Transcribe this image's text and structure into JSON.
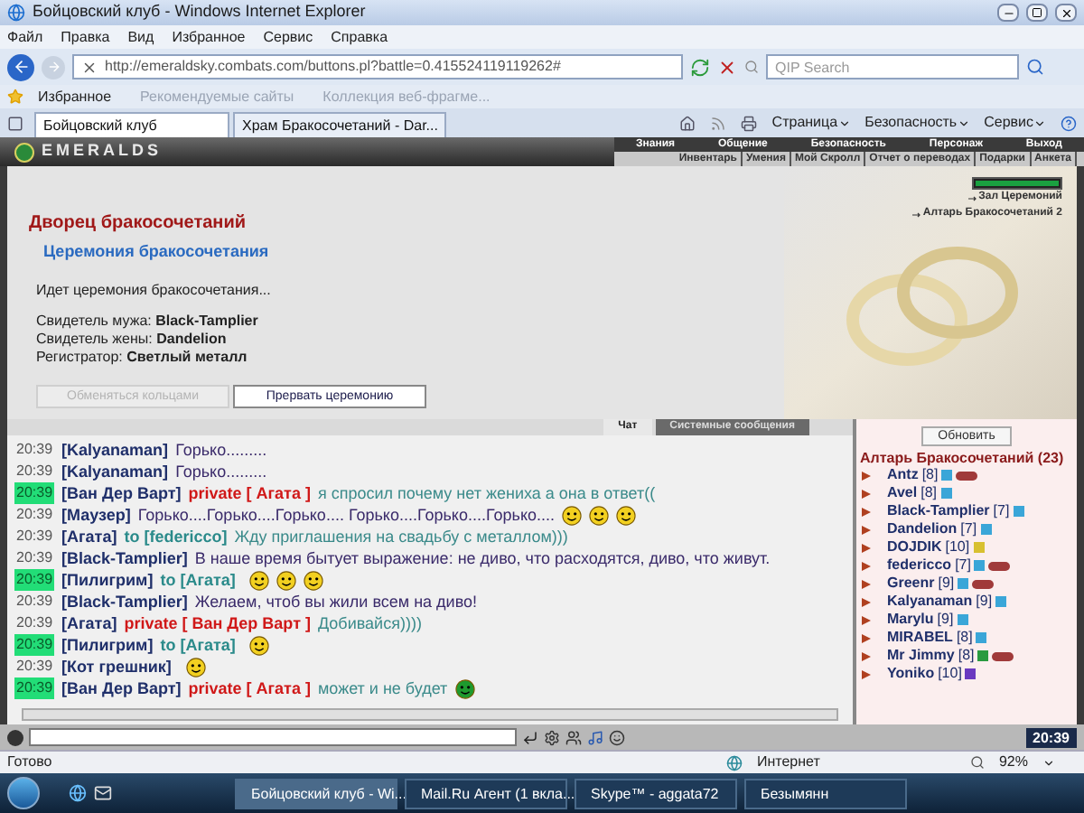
{
  "window": {
    "title": "Бойцовский клуб - Windows Internet Explorer"
  },
  "menu": [
    "Файл",
    "Правка",
    "Вид",
    "Избранное",
    "Сервис",
    "Справка"
  ],
  "address": {
    "value": "http://emeraldsky.combats.com/buttons.pl?battle=0.415524119119262#"
  },
  "search": {
    "placeholder": "QIP Search"
  },
  "favorites": {
    "label": "Избранное",
    "links": [
      "Рекомендуемые сайты",
      "Коллекция веб-фрагме..."
    ]
  },
  "tabs": [
    {
      "label": "Бойцовский клуб",
      "selected": true
    },
    {
      "label": "Храм Бракосочетаний - Dar...",
      "selected": false
    }
  ],
  "commands": [
    "Страница",
    "Безопасность",
    "Сервис"
  ],
  "game_nav": {
    "logo": "EMERALDS",
    "top": [
      "Знания",
      "Общение",
      "Безопасность",
      "Персонаж",
      "Выход"
    ],
    "sub": [
      "Инвентарь",
      "Умения",
      "Мой Скролл",
      "Отчет о переводах",
      "Подарки",
      "Анкета"
    ]
  },
  "content": {
    "title": "Дворец бракосочетаний",
    "subtitle": "Церемония бракосочетания",
    "status": "Идет церемония бракосочетания...",
    "fields": [
      {
        "label": "Свидетель мужа:",
        "value": "Black-Tamplier"
      },
      {
        "label": "Свидетель жены:",
        "value": "Dandelion"
      },
      {
        "label": "Регистратор:",
        "value": "Светлый металл"
      }
    ],
    "buttons": [
      {
        "label": "Обменяться кольцами",
        "disabled": true
      },
      {
        "label": "Прервать церемонию",
        "disabled": false
      }
    ],
    "health": {
      "level": 1
    },
    "locations": [
      "Зал Церемоний",
      "Алтарь Бракосочетаний 2"
    ]
  },
  "chat_tabs": [
    {
      "label": "Чат",
      "selected": true
    },
    {
      "label": "Системные сообщения",
      "selected": false
    }
  ],
  "messages": [
    {
      "time": "20:39",
      "highlighted": false,
      "author": "[Kalyanaman]",
      "kind": "plain",
      "text": "Горько........."
    },
    {
      "time": "20:39",
      "highlighted": false,
      "author": "[Kalyanaman]",
      "kind": "plain",
      "text": "Горько........."
    },
    {
      "time": "20:39",
      "highlighted": true,
      "author": "[Ван Дер Варт]",
      "kind": "private",
      "target": "private [ Агата ]",
      "text": "я спросил почему нет жениха а она в ответ(("
    },
    {
      "time": "20:39",
      "highlighted": false,
      "author": "[Маузер]",
      "kind": "plain",
      "text": "Горько....Горько....Горько.... Горько....Горько....Горько....",
      "smileys": [
        {
          "kind": "yellow"
        },
        {
          "kind": "yellow"
        },
        {
          "kind": "yellow"
        }
      ]
    },
    {
      "time": "20:39",
      "highlighted": false,
      "author": "[Агата]",
      "kind": "to",
      "target": "to [federicco]",
      "text": "Жду приглашения на свадьбу с металлом)))"
    },
    {
      "time": "20:39",
      "highlighted": false,
      "author": "[Black-Tamplier]",
      "kind": "plain",
      "text": "В наше время бытует выражение: не диво, что расходятся, диво, что живут."
    },
    {
      "time": "20:39",
      "highlighted": true,
      "author": "[Пилигрим]",
      "kind": "to",
      "target": "to [Агата]",
      "smileys": [
        {
          "kind": "yellow"
        },
        {
          "kind": "yellow"
        },
        {
          "kind": "yellow"
        }
      ]
    },
    {
      "time": "20:39",
      "highlighted": false,
      "author": "[Black-Tamplier]",
      "kind": "plain",
      "text": "Желаем, чтоб вы жили всем на диво!"
    },
    {
      "time": "20:39",
      "highlighted": false,
      "author": "[Агата]",
      "kind": "private",
      "target": "private [ Ван Дер Варт ]",
      "text": "Добивайся))))"
    },
    {
      "time": "20:39",
      "highlighted": true,
      "author": "[Пилигрим]",
      "kind": "to",
      "target": "to [Агата]",
      "smileys": [
        {
          "kind": "yellow"
        }
      ]
    },
    {
      "time": "20:39",
      "highlighted": false,
      "author": "[Кот грешник]",
      "kind": "plain",
      "smileys": [
        {
          "kind": "yellow"
        }
      ]
    },
    {
      "time": "20:39",
      "highlighted": true,
      "author": "[Ван Дер Варт]",
      "kind": "private",
      "target": "private [ Агата ]",
      "text": "может и не будет",
      "smileys": [
        {
          "kind": "green"
        }
      ]
    }
  ],
  "userlist": {
    "refresh": "Обновить",
    "title": "Алтарь Бракосочетаний (23)",
    "users": [
      {
        "name": "Antz",
        "level": "[8]",
        "color": "#3aa6d8",
        "ring": true
      },
      {
        "name": "Avel",
        "level": "[8]",
        "color": "#3aa6d8",
        "ring": false
      },
      {
        "name": "Black-Tamplier",
        "level": "[7]",
        "color": "#3aa6d8",
        "ring": false
      },
      {
        "name": "Dandelion",
        "level": "[7]",
        "color": "#3aa6d8",
        "ring": false
      },
      {
        "name": "DOJDIK",
        "level": "[10]",
        "color": "#d8c030",
        "ring": false
      },
      {
        "name": "federicco",
        "level": "[7]",
        "color": "#3aa6d8",
        "ring": true
      },
      {
        "name": "Greenr",
        "level": "[9]",
        "color": "#3aa6d8",
        "ring": true
      },
      {
        "name": "Kalyanaman",
        "level": "[9]",
        "color": "#3aa6d8",
        "ring": false
      },
      {
        "name": "Marylu",
        "level": "[9]",
        "color": "#3aa6d8",
        "ring": false
      },
      {
        "name": "MIRABEL",
        "level": "[8]",
        "color": "#3aa6d8",
        "ring": false
      },
      {
        "name": "Mr Jimmy",
        "level": "[8]",
        "color": "#2a9a40",
        "ring": true
      },
      {
        "name": "Yoniko",
        "level": "[10]",
        "color": "#6a3ac0",
        "ring": false
      }
    ]
  },
  "clock": "20:39",
  "status_bar": {
    "text": "Готово",
    "zone": "Интернет",
    "zoom": "92%"
  },
  "taskbar": [
    "Бойцовский клуб - Wi...",
    "Mail.Ru Агент (1 вкла...",
    "Skype™ - aggata72",
    "Безымянн"
  ]
}
